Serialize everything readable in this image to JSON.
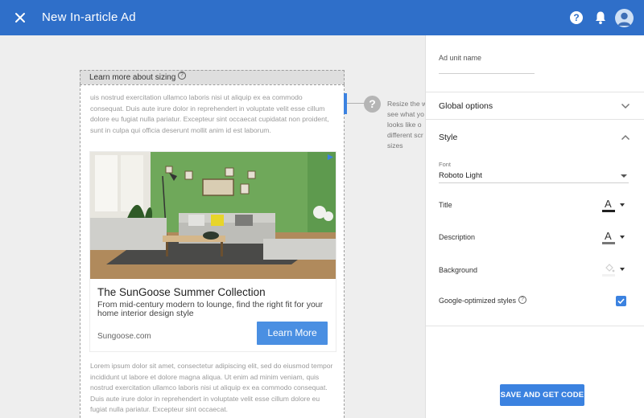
{
  "header": {
    "title": "New In-article Ad",
    "help_glyph": "?",
    "icons": [
      "close-icon",
      "help-icon",
      "bell-icon",
      "avatar-icon"
    ]
  },
  "preview": {
    "sizing_label": "Learn more about sizing",
    "top_paragraph": "uis nostrud exercitation ullamco laboris nisi ut aliquip ex ea commodo consequat. Duis aute irure dolor in reprehendert in voluptate velit esse cillum dolore eu fugiat nulla pariatur. Excepteur sint occaecat cupidatat non proident, sunt in culpa qui officia deserunt mollit anim id est laborum.",
    "bottom_paragraph": "Lorem ipsum dolor sit amet, consectetur adipiscing elit, sed do eiusmod tempor incididunt ut labore et dolore magna aliqua. Ut enim ad minim veniam, quis nostrud exercitation ullamco laboris nisi ut aliquip ex ea commodo consequat. Duis aute irure dolor in reprehendert in voluptate velit esse cillum dolore eu fugiat nulla pariatur. Excepteur sint occaecat.",
    "resize_hint_lines": [
      "Resize the w",
      "see what yo",
      "looks like o",
      "different scr",
      "sizes"
    ],
    "question_glyph": "?",
    "ad": {
      "headline": "The SunGoose Summer Collection",
      "description": "From mid-century modern to lounge, find the right fit for your home interior design style",
      "domain": "Sungoose.com",
      "cta": "Learn More"
    }
  },
  "panel": {
    "ad_unit_name_label": "Ad unit name",
    "global_options": "Global options",
    "style": "Style",
    "font_label": "Font",
    "font_value": "Roboto Light",
    "title_label": "Title",
    "description_label": "Description",
    "background_label": "Background",
    "google_optimized_label": "Google-optimized styles",
    "google_optimized_checked": true,
    "info_glyph": "?",
    "save_button": "SAVE AND GET CODE",
    "picker_glyph": "A"
  },
  "colors": {
    "header_blue": "#2f6fc9",
    "accent_blue": "#3b82e0",
    "wall_green": "#6fa85a"
  }
}
